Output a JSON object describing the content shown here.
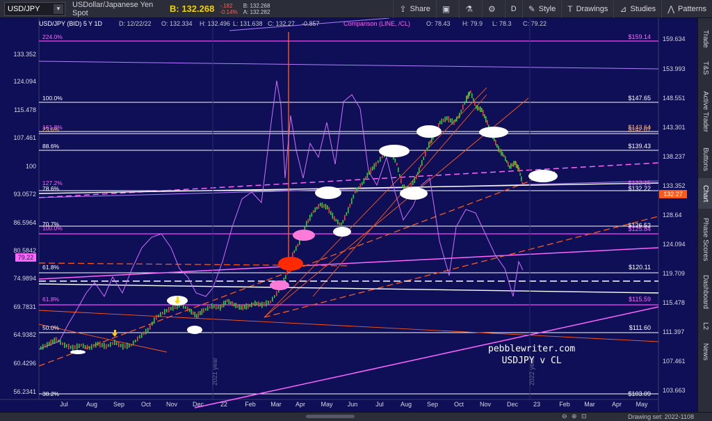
{
  "toolbar": {
    "symbol": "USD/JPY",
    "description": "USDollar/Japanese Yen Spot",
    "last": "B: 132.268",
    "change": "-.182",
    "change_pct": "-0.14%",
    "bid": "B: 132.268",
    "ask": "A: 132.282",
    "share": "Share",
    "interval": "D",
    "style": "Style",
    "drawings": "Drawings",
    "studies": "Studies",
    "patterns": "Patterns"
  },
  "header": {
    "instrument": "USD/JPY (BID) 5 Y 1D",
    "date": "D: 12/22/22",
    "open": "O: 132.334",
    "high": "H: 132.496",
    "low": "L: 131.638",
    "close": "C: 132.27",
    "change": "-0.857",
    "comparison": "Comparison (LINE, /CL)",
    "c_open": "O: 78.43",
    "c_high": "H: 79.9",
    "c_low": "L: 78.3",
    "c_close": "C: 79.22"
  },
  "side_tabs": [
    "Trade",
    "T&S",
    "Active Trader",
    "Buttons",
    "Chart",
    "Phase Scores",
    "Dashboard",
    "L2",
    "News"
  ],
  "active_tab": "Chart",
  "left_axis": [
    "133.352",
    "124.094",
    "115.478",
    "107.461",
    "100",
    "93.0572",
    "86.5964",
    "80.5842",
    "74.9894",
    "69.7831",
    "64.9382",
    "60.4296",
    "56.2341"
  ],
  "left_marker": "79.22",
  "right_axis": [
    "159.634",
    "153.993",
    "148.551",
    "143.301",
    "138.237",
    "133.352",
    "128.64",
    "124.094",
    "119.709",
    "115.478",
    "111.397",
    "107.461",
    "103.663"
  ],
  "price_marker": "132.27",
  "x_axis": [
    "Jul",
    "Aug",
    "Sep",
    "Oct",
    "Nov",
    "Dec",
    "22",
    "Feb",
    "Mar",
    "Apr",
    "May",
    "Jun",
    "Jul",
    "Aug",
    "Sep",
    "Oct",
    "Nov",
    "Dec",
    "23",
    "Feb",
    "Mar",
    "Apr",
    "May"
  ],
  "fib_left": [
    "224.0%",
    "100.0%",
    "161.8%",
    "23.6%",
    "88.6%",
    "127.2%",
    "78.6%",
    "70.7%",
    "100.0%",
    "61.8%",
    "61.8%",
    "50.0%",
    "38.2%"
  ],
  "fib_right": [
    "$159.14",
    "$147.65",
    "$143.64",
    "$142.07",
    "$139.43",
    "$133.15",
    "$132.22",
    "$126.52",
    "$125.84",
    "$120.11",
    "$115.59",
    "$111.60",
    "$103.09"
  ],
  "year_labels": [
    "2021 year",
    "2022 year"
  ],
  "watermark": [
    "pebblewriter.com",
    "USDJPY v CL"
  ],
  "statusbar": {
    "drawing_set": "Drawing set: 2022-1108"
  },
  "colors": {
    "background": "#0e0f56",
    "candles": "#33cc33",
    "comparison": "#ff66ff",
    "fib": "#ffffff",
    "channel": "#ff5a1a"
  }
}
